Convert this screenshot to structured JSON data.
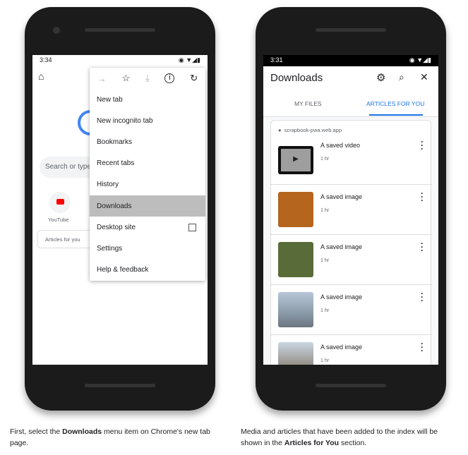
{
  "left_phone": {
    "status_time": "3:34",
    "search_placeholder": "Search or type",
    "shortcut_label": "YouTube",
    "articles_label": "Articles for you",
    "menu_items": [
      "New tab",
      "New incognito tab",
      "Bookmarks",
      "Recent tabs",
      "History",
      "Downloads",
      "Desktop site",
      "Settings",
      "Help & feedback"
    ],
    "selected_item": "Downloads",
    "toolbar_icons": [
      "forward-icon",
      "star-icon",
      "download-icon",
      "info-icon",
      "refresh-icon"
    ]
  },
  "right_phone": {
    "status_time": "3:31",
    "title": "Downloads",
    "tabs": [
      "MY FILES",
      "ARTICLES FOR YOU"
    ],
    "active_tab": "ARTICLES FOR YOU",
    "accent": "#1a73e8",
    "source": "scrapbook-pwa.web.app",
    "items": [
      {
        "title": "A saved video",
        "age": "1 hr"
      },
      {
        "title": "A saved image",
        "age": "1 hr"
      },
      {
        "title": "A saved image",
        "age": "1 hr"
      },
      {
        "title": "A saved image",
        "age": "1 hr"
      },
      {
        "title": "A saved image",
        "age": "1 hr"
      }
    ]
  },
  "captions": {
    "left": {
      "pre": "First, select the ",
      "bold": "Downloads",
      "post": " menu item on Chrome's new tab page."
    },
    "right": {
      "pre": "Media and articles that have been added to the index will be shown in the ",
      "bold": "Articles for You",
      "post": " section."
    }
  }
}
